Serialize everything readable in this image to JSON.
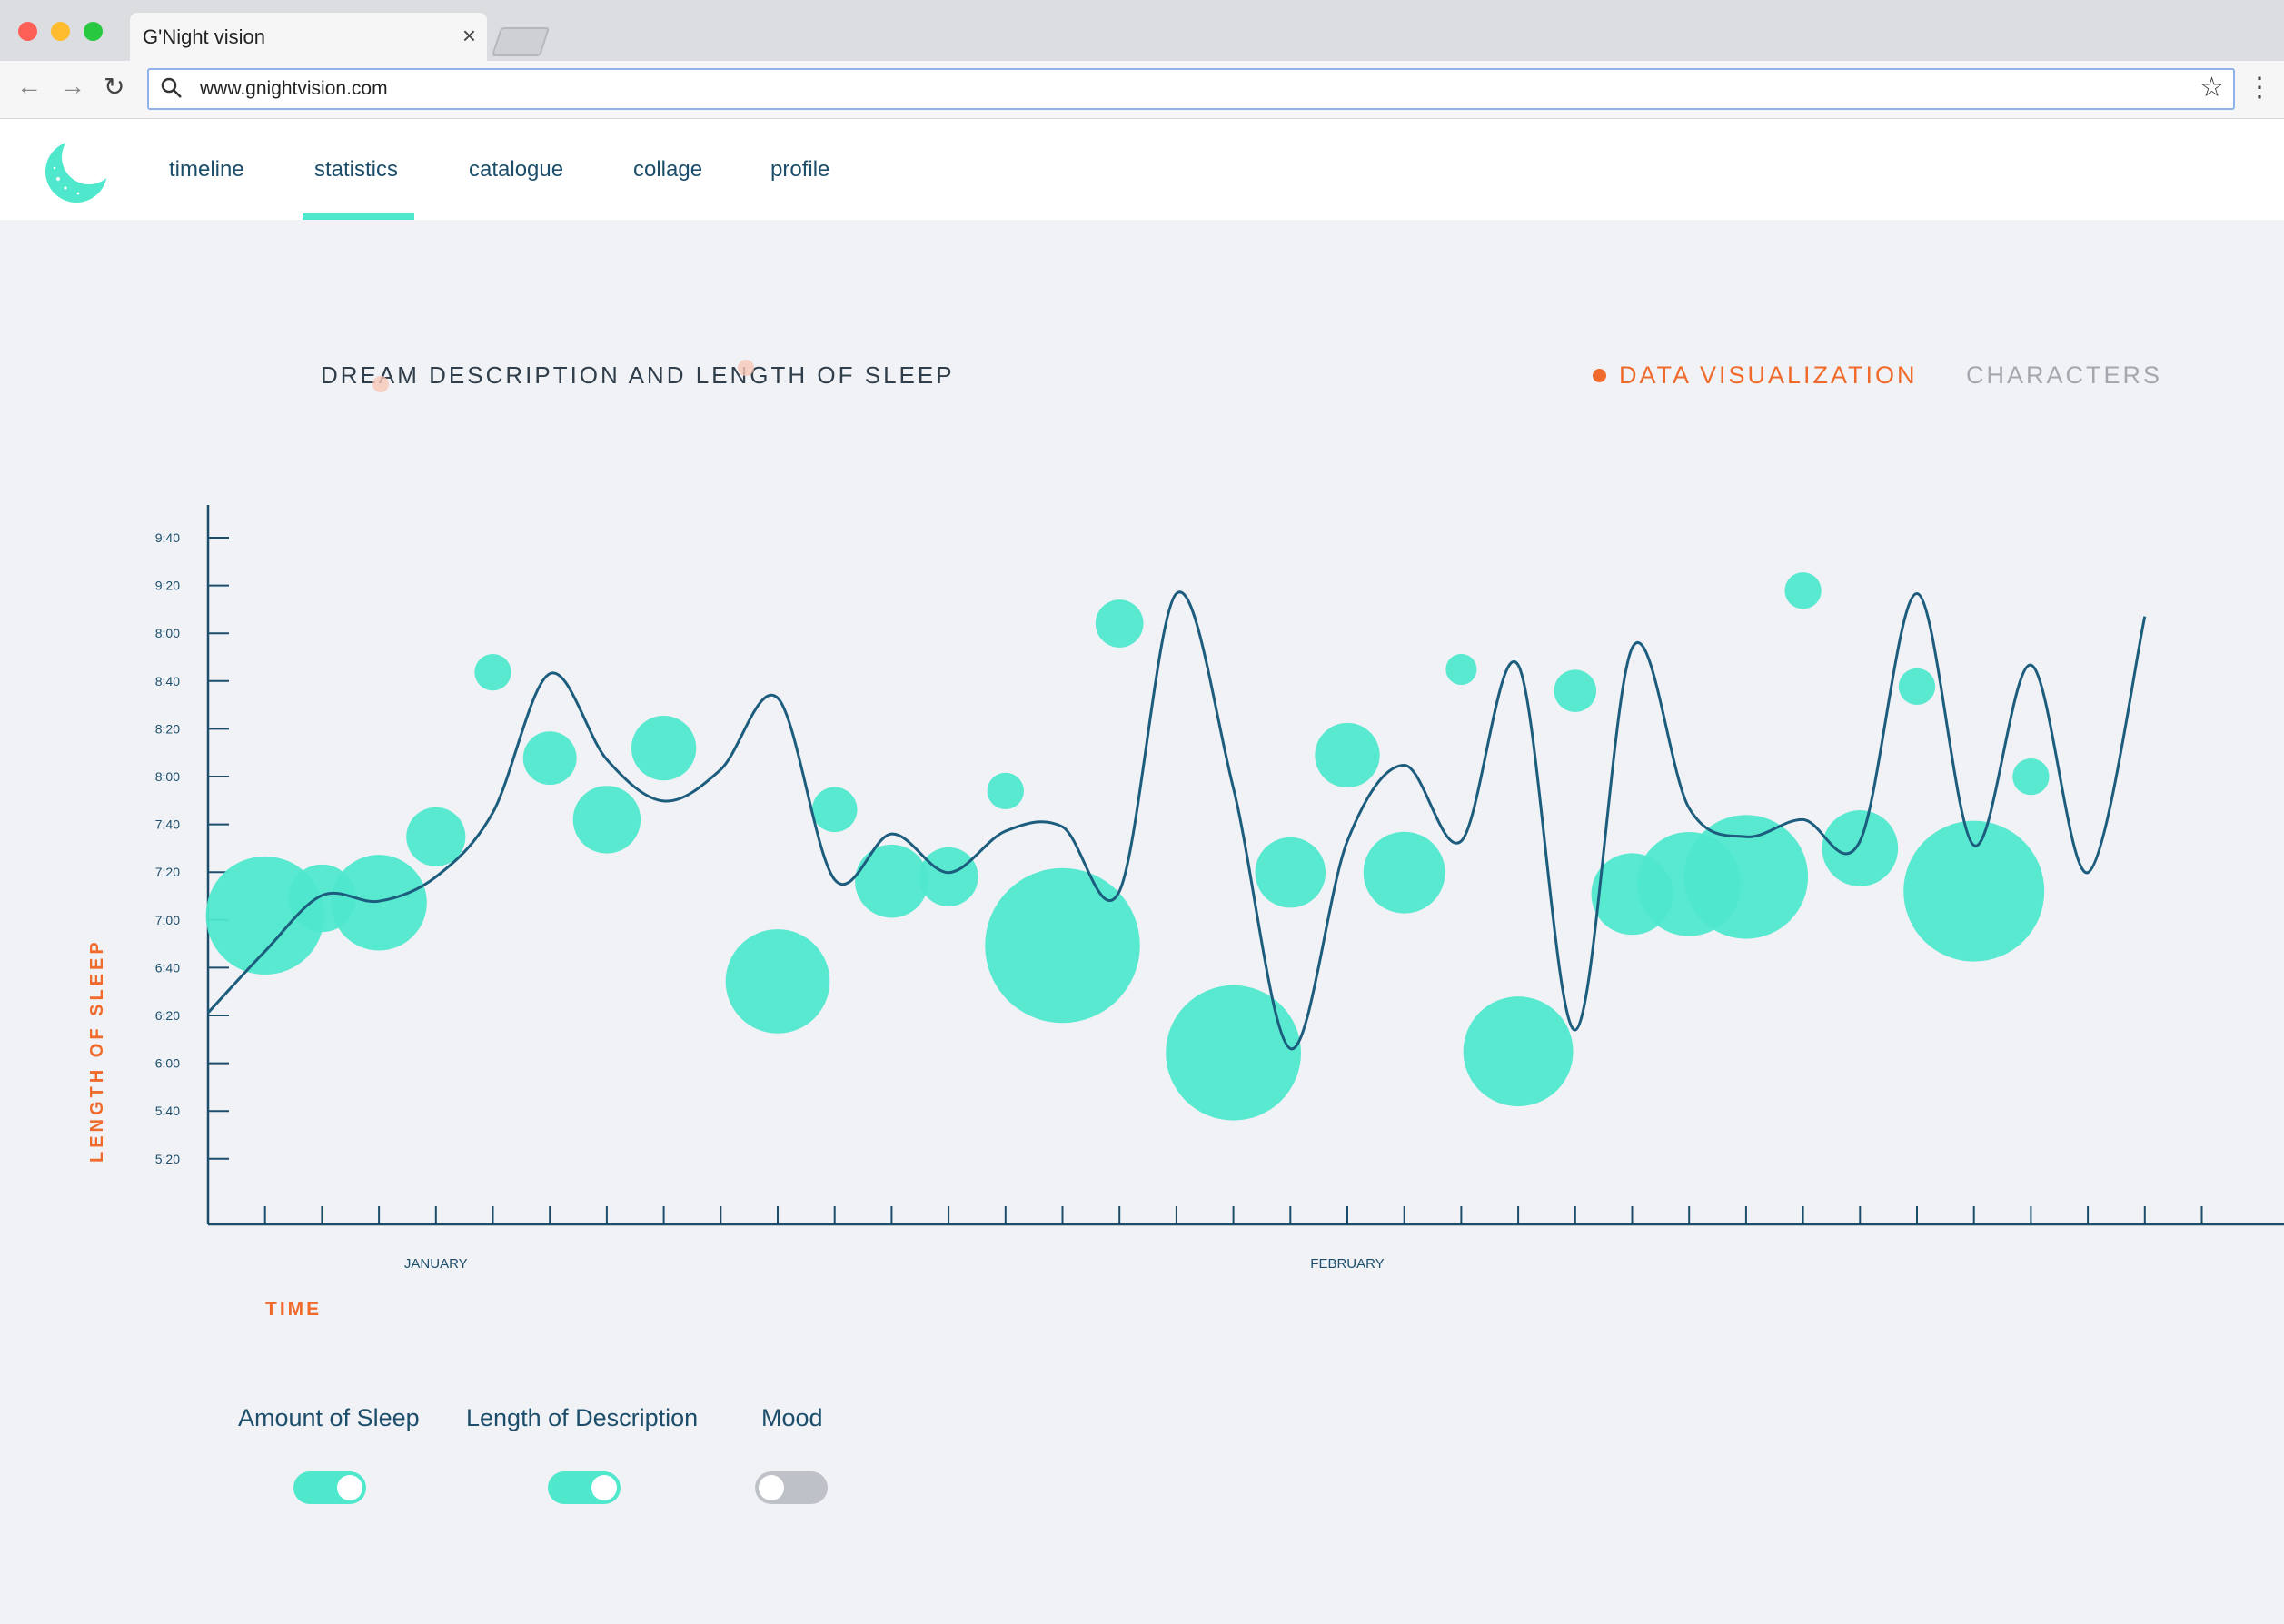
{
  "browser": {
    "tab_title": "G'Night vision",
    "url": "www.gnightvision.com"
  },
  "nav": {
    "items": [
      "timeline",
      "statistics",
      "catalogue",
      "collage",
      "profile"
    ],
    "active": "statistics"
  },
  "section": {
    "title": "DREAM DESCRIPTION AND LENGTH OF SLEEP",
    "view_toggle_active": "DATA VISUALIZATION",
    "view_toggle_inactive": "CHARACTERS"
  },
  "controls": {
    "amount_of_sleep": {
      "label": "Amount of Sleep",
      "on": true
    },
    "length_of_description": {
      "label": "Length of Description",
      "on": true
    },
    "mood": {
      "label": "Mood",
      "on": false
    }
  },
  "colors": {
    "accent": "#4fe8cd",
    "line": "#1c5d7e",
    "axis": "#1c4e6b",
    "highlight": "#f06a2c",
    "inactive": "#a4a8ae"
  },
  "chart_data": {
    "type": "scatter",
    "xlabel": "TIME",
    "ylabel": "LENGTH OF SLEEP",
    "y_tick_labels": [
      "9:40",
      "9:20",
      "8:00",
      "8:40",
      "8:20",
      "8:00",
      "7:40",
      "7:20",
      "7:00",
      "6:40",
      "6:20",
      "6:00",
      "5:40",
      "5:20"
    ],
    "x_month_labels": [
      "JANUARY",
      "FEBRUARY"
    ],
    "x_ticks": 35,
    "series": [
      {
        "kind": "line",
        "values": [
          6.35,
          6.78,
          7.17,
          7.13,
          7.3,
          7.75,
          8.72,
          8.12,
          7.83,
          8.05,
          8.55,
          7.28,
          7.6,
          7.33,
          7.62,
          7.65,
          7.2,
          9.28,
          7.92,
          6.1,
          7.55,
          8.08,
          7.55,
          8.78,
          6.23,
          8.9,
          7.78,
          7.58,
          7.7,
          7.55,
          9.28,
          7.52,
          8.78,
          7.33,
          9.12
        ]
      },
      {
        "kind": "bubbles",
        "y": [
          7.03,
          7.15,
          7.12,
          7.58,
          8.73,
          8.13,
          7.7,
          8.2,
          6.57,
          7.77,
          7.27,
          7.3,
          7.9,
          6.82,
          9.07,
          6.07,
          7.33,
          8.15,
          7.33,
          8.75,
          6.08,
          8.6,
          7.18,
          7.25,
          7.3,
          9.3,
          7.5,
          8.63,
          7.2,
          8.0
        ],
        "x_index": [
          1,
          2,
          3,
          4,
          5,
          6,
          7,
          8,
          10,
          11,
          12,
          13,
          14,
          15,
          16,
          18,
          19,
          20,
          21,
          22,
          23,
          24,
          25,
          26,
          27,
          28,
          29,
          30,
          31,
          32
        ],
        "size": [
          42,
          24,
          34,
          21,
          13,
          19,
          24,
          23,
          37,
          16,
          26,
          21,
          13,
          55,
          17,
          48,
          25,
          23,
          29,
          11,
          39,
          15,
          29,
          37,
          44,
          13,
          27,
          13,
          50,
          13
        ]
      }
    ]
  }
}
